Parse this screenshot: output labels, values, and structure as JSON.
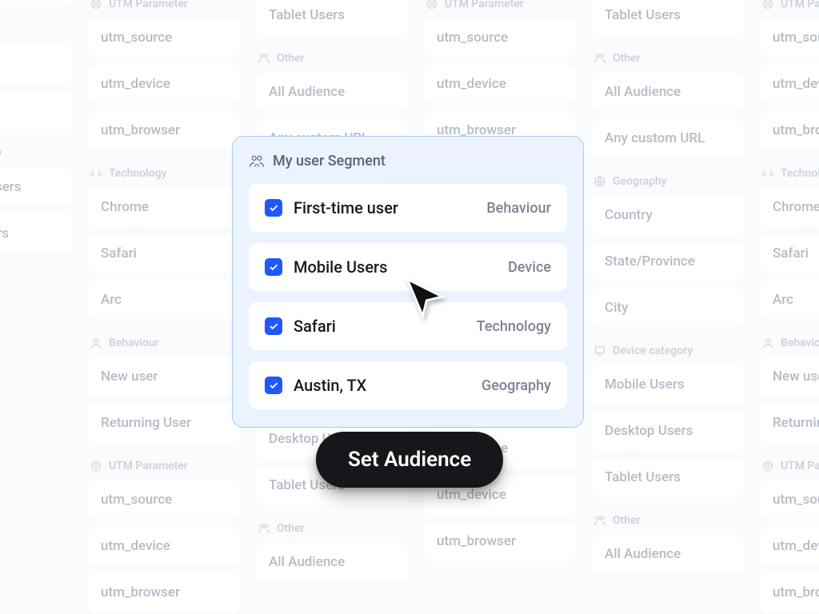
{
  "card": {
    "title": "My user Segment",
    "rows": [
      {
        "label": "First-time user",
        "category": "Behaviour"
      },
      {
        "label": "Mobile Users",
        "category": "Device"
      },
      {
        "label": "Safari",
        "category": "Technology"
      },
      {
        "label": "Austin, TX",
        "category": "Geography"
      }
    ]
  },
  "cta_label": "Set Audience",
  "bg_sections": {
    "utm": {
      "head": "UTM Parameter",
      "items": [
        "utm_source",
        "utm_device",
        "utm_browser"
      ]
    },
    "technology": {
      "head": "Technology",
      "items": [
        "Chrome",
        "Safari",
        "Arc"
      ]
    },
    "behaviour": {
      "head": "Behaviour",
      "items": [
        "New user",
        "Returning User"
      ]
    },
    "other": {
      "head": "Other",
      "items": [
        "All Audience",
        "Any custom URL"
      ]
    },
    "geography": {
      "head": "Geography",
      "items": [
        "Country",
        "State/Province",
        "City"
      ]
    },
    "device": {
      "head": "Device category",
      "items": [
        "Mobile Users",
        "Desktop Users",
        "Tablet Users"
      ]
    }
  }
}
